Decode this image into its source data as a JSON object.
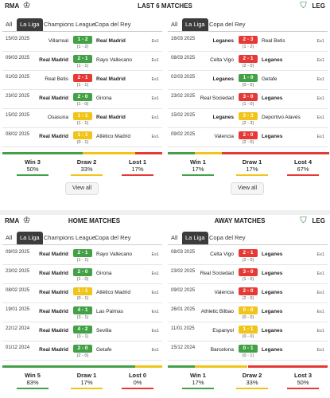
{
  "colors": {
    "win": "#43a047",
    "draw": "#f0c419",
    "loss": "#e53935"
  },
  "last6": {
    "team_left": "RMA",
    "team_right": "LEG",
    "title": "LAST 6 MATCHES",
    "left": {
      "tabs": [
        "All",
        "La Liga",
        "Champions League",
        "Copa del Rey"
      ],
      "matches": [
        {
          "date": "15/03 2025",
          "home": "Villarreal",
          "away": "Real Madrid",
          "score": "1 - 2",
          "ht": "(1 - 2)",
          "comp": "Es1",
          "result": "win",
          "home_bold": false,
          "away_bold": true
        },
        {
          "date": "09/03 2025",
          "home": "Real Madrid",
          "away": "Rayo Vallecano",
          "score": "2 - 1",
          "ht": "(1 - 1)",
          "comp": "Es1",
          "result": "win",
          "home_bold": true,
          "away_bold": false
        },
        {
          "date": "01/03 2025",
          "home": "Real Betis",
          "away": "Real Madrid",
          "score": "2 - 1",
          "ht": "(1 - 1)",
          "comp": "Es1",
          "result": "loss",
          "home_bold": false,
          "away_bold": true
        },
        {
          "date": "23/02 2025",
          "home": "Real Madrid",
          "away": "Girona",
          "score": "2 - 0",
          "ht": "(1 - 0)",
          "comp": "Es1",
          "result": "win",
          "home_bold": true,
          "away_bold": false
        },
        {
          "date": "15/02 2025",
          "home": "Osasuna",
          "away": "Real Madrid",
          "score": "1 - 1",
          "ht": "(1 - 1)",
          "comp": "Es1",
          "result": "draw",
          "home_bold": false,
          "away_bold": true
        },
        {
          "date": "08/02 2025",
          "home": "Real Madrid",
          "away": "Atlético Madrid",
          "score": "1 - 1",
          "ht": "(0 - 1)",
          "comp": "Es1",
          "result": "draw",
          "home_bold": true,
          "away_bold": false
        }
      ],
      "stats": {
        "win_label": "Win 3",
        "win_pct": "50%",
        "draw_label": "Draw 2",
        "draw_pct": "33%",
        "loss_label": "Lost 1",
        "loss_pct": "17%",
        "win_frac": 0.5,
        "draw_frac": 0.33,
        "loss_frac": 0.17
      },
      "view_all": "View all"
    },
    "right": {
      "tabs": [
        "All",
        "La Liga",
        "Copa del Rey"
      ],
      "matches": [
        {
          "date": "16/03 2025",
          "home": "Leganes",
          "away": "Real Betis",
          "score": "2 - 3",
          "ht": "(1 - 2)",
          "comp": "Es1",
          "result": "loss",
          "home_bold": true,
          "away_bold": false
        },
        {
          "date": "08/03 2025",
          "home": "Celta Vigo",
          "away": "Leganes",
          "score": "2 - 1",
          "ht": "(2 - 0)",
          "comp": "Es1",
          "result": "loss",
          "home_bold": false,
          "away_bold": true
        },
        {
          "date": "02/03 2025",
          "home": "Leganes",
          "away": "Getafe",
          "score": "1 - 0",
          "ht": "(0 - 0)",
          "comp": "Es1",
          "result": "win",
          "home_bold": true,
          "away_bold": false
        },
        {
          "date": "23/02 2025",
          "home": "Real Sociedad",
          "away": "Leganes",
          "score": "3 - 0",
          "ht": "(1 - 0)",
          "comp": "Es1",
          "result": "loss",
          "home_bold": false,
          "away_bold": true
        },
        {
          "date": "15/02 2025",
          "home": "Leganes",
          "away": "Deportivo Alavés",
          "score": "3 - 3",
          "ht": "(2 - 3)",
          "comp": "Es1",
          "result": "draw",
          "home_bold": true,
          "away_bold": false
        },
        {
          "date": "09/02 2025",
          "home": "Valencia",
          "away": "Leganes",
          "score": "2 - 0",
          "ht": "(2 - 0)",
          "comp": "Es1",
          "result": "loss",
          "home_bold": false,
          "away_bold": true
        }
      ],
      "stats": {
        "win_label": "Win 1",
        "win_pct": "17%",
        "draw_label": "Draw 1",
        "draw_pct": "17%",
        "loss_label": "Lost 4",
        "loss_pct": "67%",
        "win_frac": 0.17,
        "draw_frac": 0.17,
        "loss_frac": 0.67
      },
      "view_all": "View all"
    }
  },
  "home": {
    "team": "RMA",
    "title": "HOME MATCHES",
    "tabs": [
      "All",
      "La Liga",
      "Champions League",
      "Copa del Rey"
    ],
    "matches": [
      {
        "date": "09/03 2025",
        "home": "Real Madrid",
        "away": "Rayo Vallecano",
        "score": "2 - 1",
        "ht": "(1 - 1)",
        "comp": "Es1",
        "result": "win",
        "home_bold": true,
        "away_bold": false
      },
      {
        "date": "23/02 2025",
        "home": "Real Madrid",
        "away": "Girona",
        "score": "2 - 0",
        "ht": "(1 - 0)",
        "comp": "Es1",
        "result": "win",
        "home_bold": true,
        "away_bold": false
      },
      {
        "date": "08/02 2025",
        "home": "Real Madrid",
        "away": "Atlético Madrid",
        "score": "1 - 1",
        "ht": "(0 - 1)",
        "comp": "Es1",
        "result": "draw",
        "home_bold": true,
        "away_bold": false
      },
      {
        "date": "19/01 2025",
        "home": "Real Madrid",
        "away": "Las Palmas",
        "score": "4 - 1",
        "ht": "(3 - 1)",
        "comp": "Es1",
        "result": "win",
        "home_bold": true,
        "away_bold": false
      },
      {
        "date": "22/12 2024",
        "home": "Real Madrid",
        "away": "Sevilla",
        "score": "4 - 2",
        "ht": "(3 - 1)",
        "comp": "Es1",
        "result": "win",
        "home_bold": true,
        "away_bold": false
      },
      {
        "date": "01/12 2024",
        "home": "Real Madrid",
        "away": "Getafe",
        "score": "2 - 0",
        "ht": "(2 - 0)",
        "comp": "Es1",
        "result": "win",
        "home_bold": true,
        "away_bold": false
      }
    ],
    "stats": {
      "win_label": "Win 5",
      "win_pct": "83%",
      "draw_label": "Draw 1",
      "draw_pct": "17%",
      "loss_label": "Lost 0",
      "loss_pct": "0%",
      "win_frac": 0.83,
      "draw_frac": 0.17,
      "loss_frac": 0.0
    }
  },
  "away": {
    "team": "LEG",
    "title": "AWAY MATCHES",
    "tabs": [
      "All",
      "La Liga",
      "Copa del Rey"
    ],
    "matches": [
      {
        "date": "08/03 2025",
        "home": "Celta Vigo",
        "away": "Leganes",
        "score": "2 - 1",
        "ht": "(2 - 0)",
        "comp": "Es1",
        "result": "loss",
        "home_bold": false,
        "away_bold": true
      },
      {
        "date": "23/02 2025",
        "home": "Real Sociedad",
        "away": "Leganes",
        "score": "3 - 0",
        "ht": "(1 - 0)",
        "comp": "Es1",
        "result": "loss",
        "home_bold": false,
        "away_bold": true
      },
      {
        "date": "09/02 2025",
        "home": "Valencia",
        "away": "Leganes",
        "score": "2 - 0",
        "ht": "(2 - 0)",
        "comp": "Es1",
        "result": "loss",
        "home_bold": false,
        "away_bold": true
      },
      {
        "date": "26/01 2025",
        "home": "Athletic Bilbao",
        "away": "Leganes",
        "score": "0 - 0",
        "ht": "(0 - 0)",
        "comp": "Es1",
        "result": "draw",
        "home_bold": false,
        "away_bold": true
      },
      {
        "date": "11/01 2025",
        "home": "Espanyol",
        "away": "Leganes",
        "score": "1 - 1",
        "ht": "(0 - 0)",
        "comp": "Es1",
        "result": "draw",
        "home_bold": false,
        "away_bold": true
      },
      {
        "date": "15/12 2024",
        "home": "Barcelona",
        "away": "Leganes",
        "score": "0 - 1",
        "ht": "(0 - 1)",
        "comp": "Es1",
        "result": "win",
        "home_bold": false,
        "away_bold": true
      }
    ],
    "stats": {
      "win_label": "Win 1",
      "win_pct": "17%",
      "draw_label": "Draw 2",
      "draw_pct": "33%",
      "loss_label": "Lost 3",
      "loss_pct": "50%",
      "win_frac": 0.17,
      "draw_frac": 0.33,
      "loss_frac": 0.5
    }
  }
}
